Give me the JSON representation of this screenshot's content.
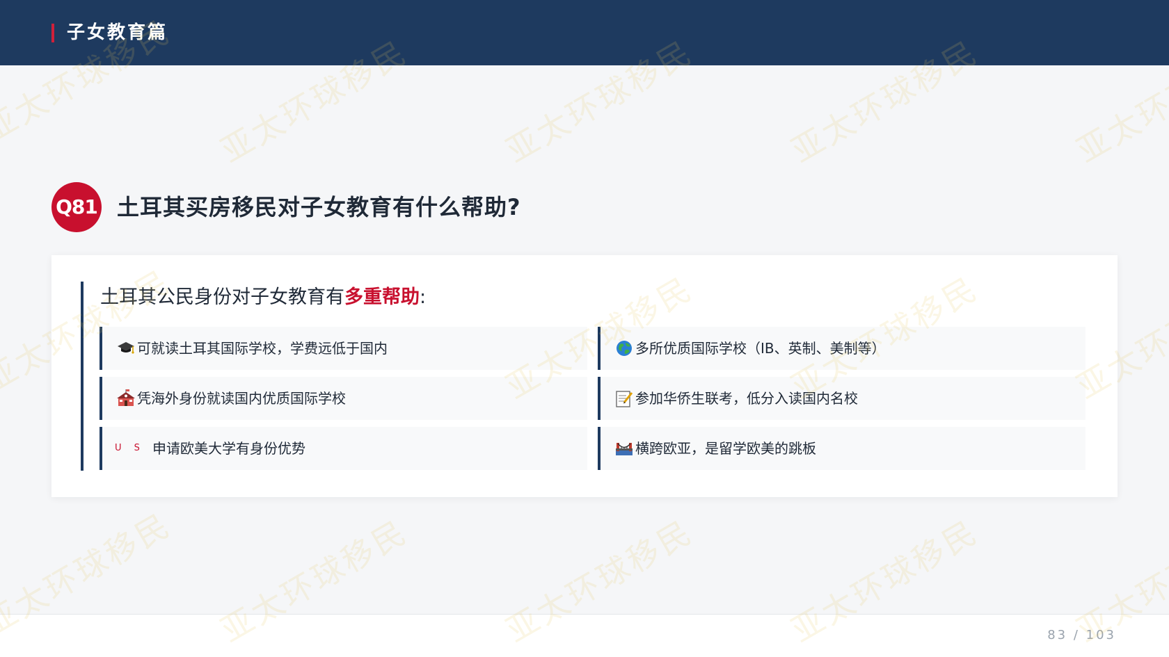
{
  "header": {
    "title": "子女教育篇"
  },
  "watermark": {
    "text": "亚太环球移民"
  },
  "question": {
    "number": "Q81",
    "title": "土耳其买房移民对子女教育有什么帮助?"
  },
  "card": {
    "heading_prefix": "土耳其公民身份对子女教育有",
    "heading_highlight": "多重帮助",
    "heading_suffix": ":",
    "items": [
      {
        "icon": "graduation-cap-icon",
        "text": "可就读土耳其国际学校，学费远低于国内"
      },
      {
        "icon": "globe-icon",
        "text": "多所优质国际学校（IB、英制、美制等）"
      },
      {
        "icon": "school-icon",
        "text": "凭海外身份就读国内优质国际学校"
      },
      {
        "icon": "memo-icon",
        "text": "参加华侨生联考，低分入读国内名校"
      },
      {
        "icon": "us-flag-icon",
        "icon_label": "U S",
        "text": "申请欧美大学有身份优势"
      },
      {
        "icon": "bridge-icon",
        "text": "横跨欧亚，是留学欧美的跳板"
      }
    ]
  },
  "footer": {
    "page": "83 / 103"
  },
  "colors": {
    "navy": "#1e3a5f",
    "accent_red": "#c8102e",
    "background": "#f5f6f8"
  }
}
